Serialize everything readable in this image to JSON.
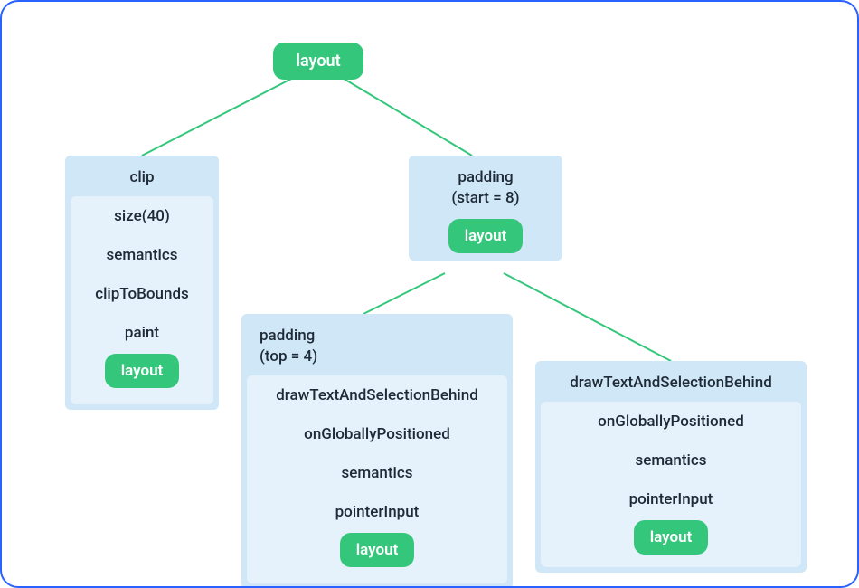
{
  "root": {
    "label": "layout"
  },
  "colors": {
    "accent": "#34c77b",
    "node_bg": "#cfe7f7",
    "nest_bg": "#e5f1fb",
    "border": "#2962ff"
  },
  "nodes": {
    "left": {
      "rows": [
        "clip",
        "size(40)",
        "semantics",
        "clipToBounds",
        "paint"
      ],
      "terminal": "layout"
    },
    "right_top": {
      "rows": [
        "padding\n(start = 8)"
      ],
      "terminal": "layout"
    },
    "bottom_left": {
      "rows": [
        "padding\n(top = 4)",
        "drawTextAndSelectionBehind",
        "onGloballyPositioned",
        "semantics",
        "pointerInput"
      ],
      "terminal": "layout"
    },
    "bottom_right": {
      "rows": [
        "drawTextAndSelectionBehind",
        "onGloballyPositioned",
        "semantics",
        "pointerInput"
      ],
      "terminal": "layout"
    }
  }
}
